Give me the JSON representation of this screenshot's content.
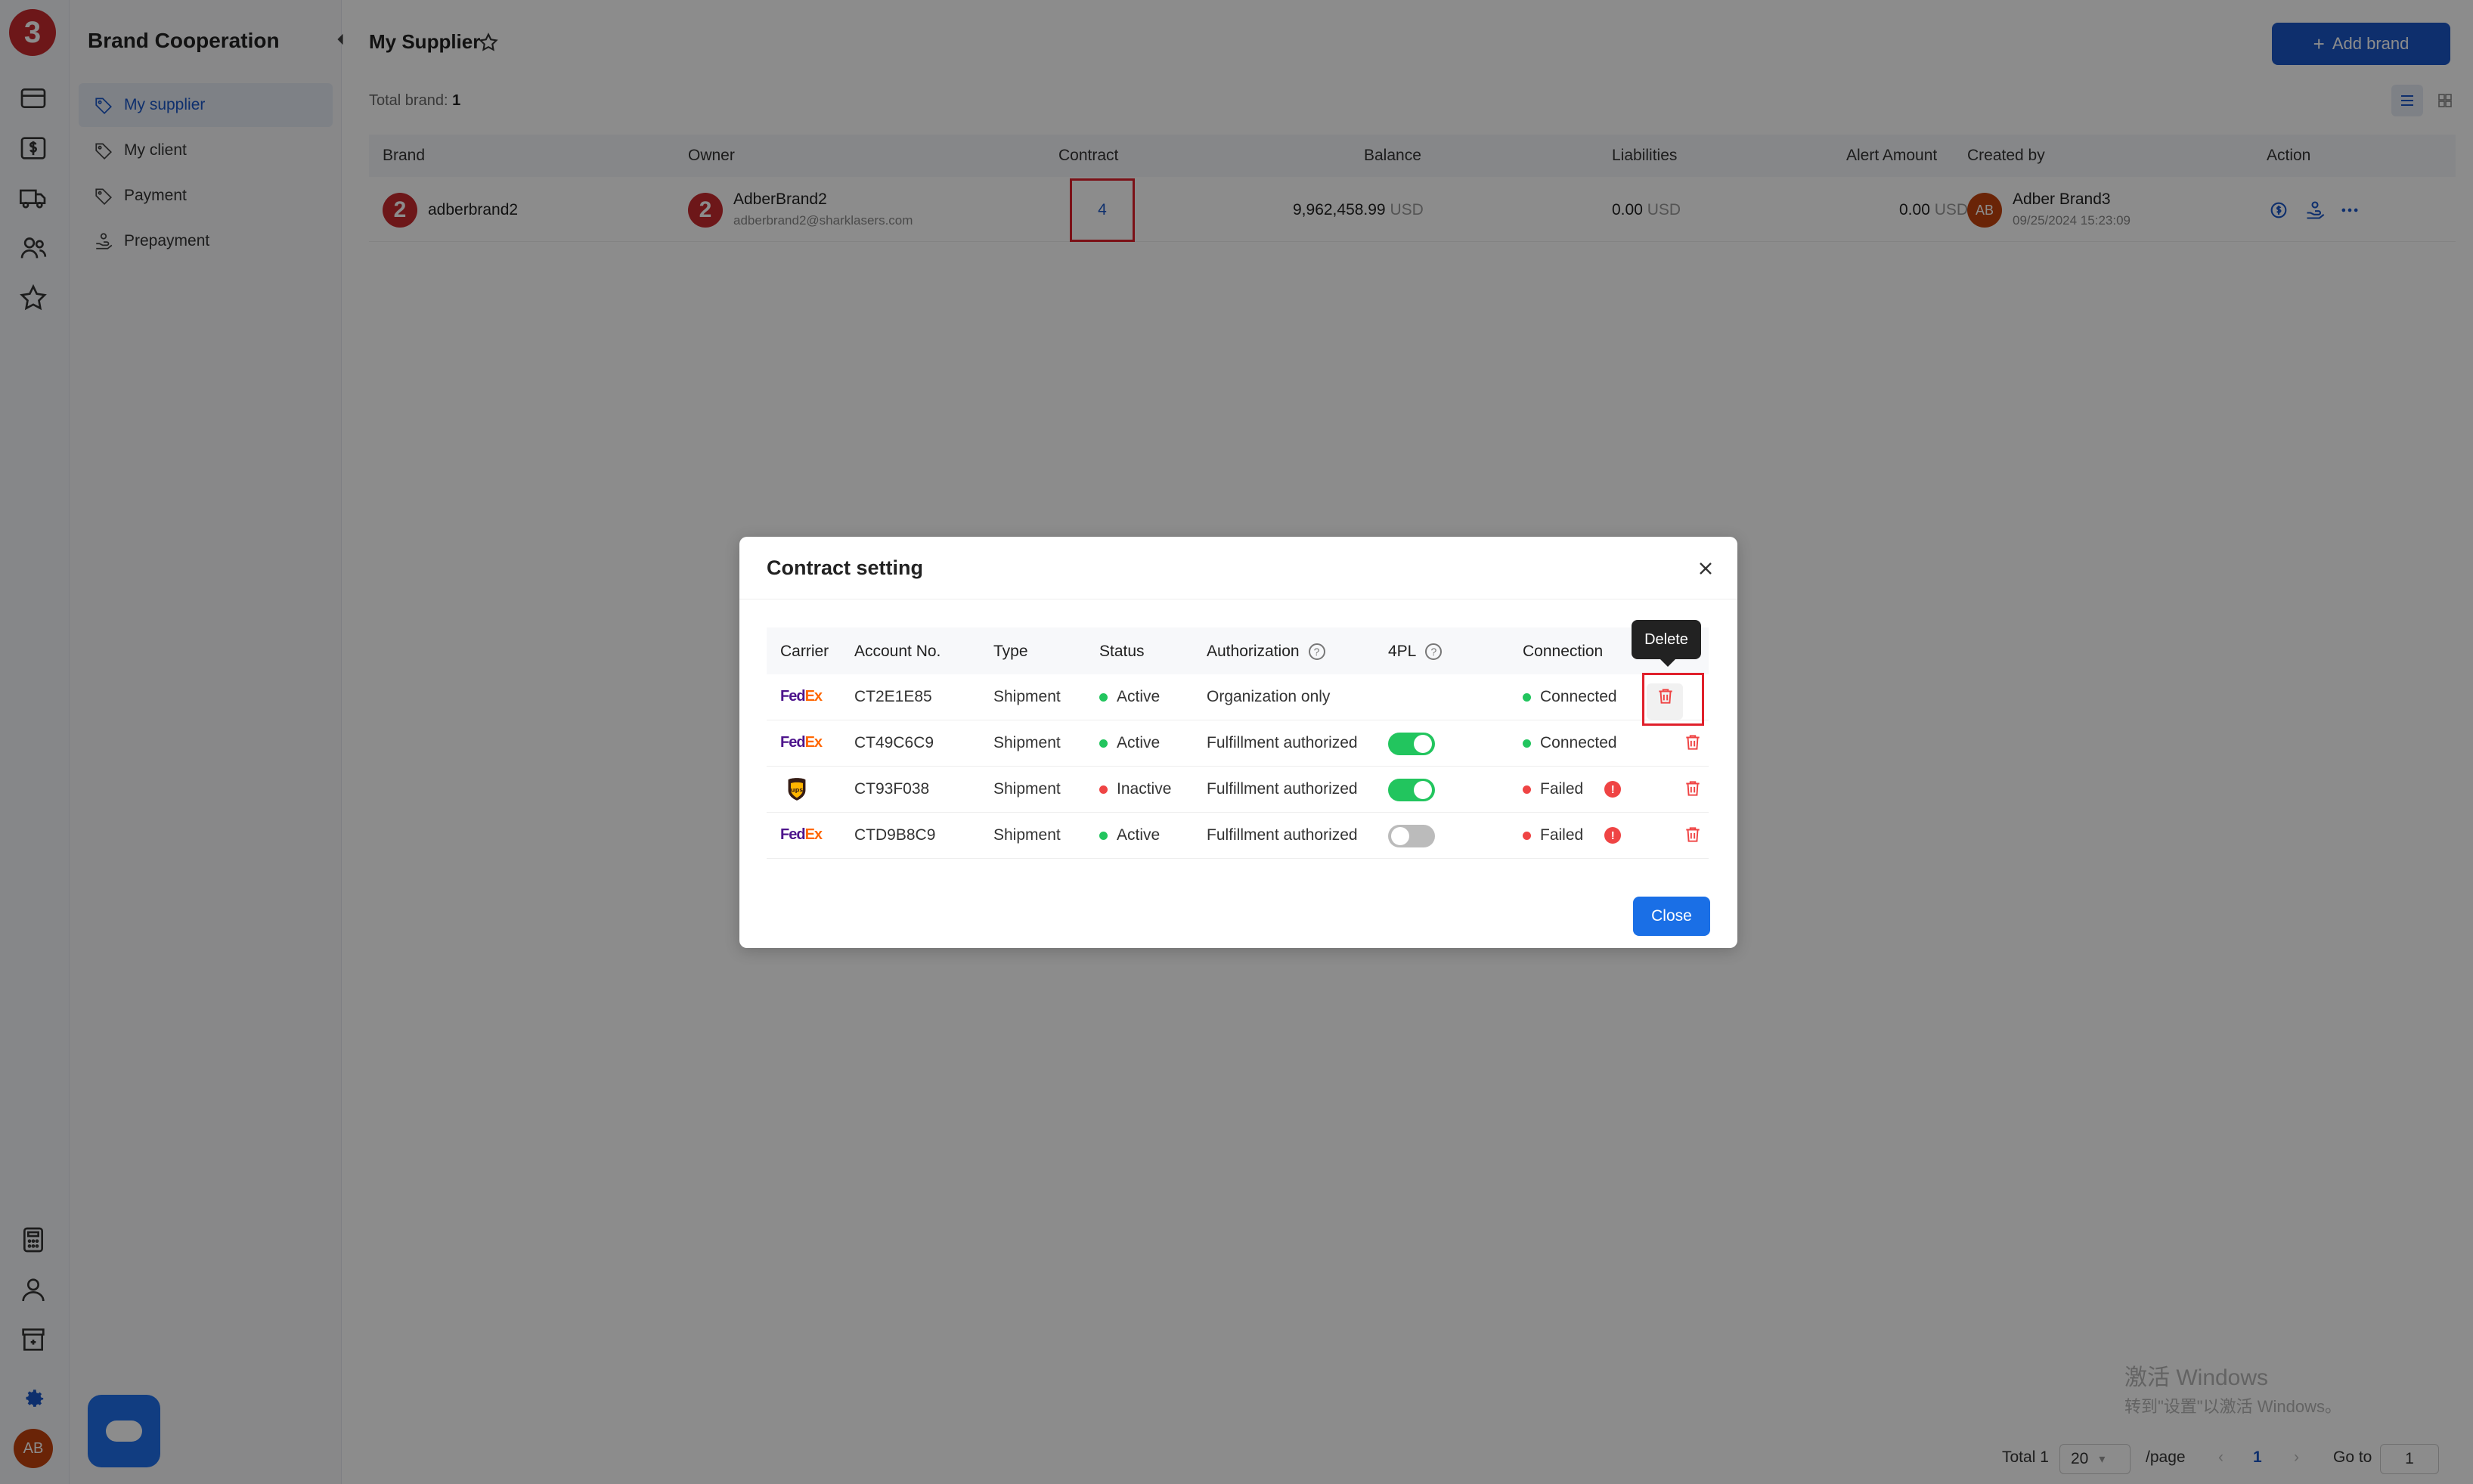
{
  "rail": {
    "logo_number": "3",
    "avatar": "AB",
    "icons": [
      "card-icon",
      "dollar-icon",
      "truck-icon",
      "users-icon",
      "star-icon",
      "calculator-icon",
      "user-icon",
      "store-icon",
      "settings-icon"
    ]
  },
  "sidebar": {
    "title": "Brand Cooperation",
    "items": [
      {
        "label": "My supplier",
        "icon": "tag-icon",
        "active": true
      },
      {
        "label": "My client",
        "icon": "tag-icon",
        "active": false
      },
      {
        "label": "Payment",
        "icon": "tag-icon",
        "active": false
      },
      {
        "label": "Prepayment",
        "icon": "hand-coin-icon",
        "active": false
      }
    ]
  },
  "header": {
    "title": "My Supplier",
    "add_button": "Add brand",
    "total_label": "Total brand:",
    "total_value": "1"
  },
  "table": {
    "columns": [
      "Brand",
      "Owner",
      "Contract",
      "Balance",
      "Liabilities",
      "Alert Amount",
      "Created by",
      "Action"
    ],
    "rows": [
      {
        "brand_avatar": "2",
        "brand": "adberbrand2",
        "owner_avatar": "2",
        "owner_name": "AdberBrand2",
        "owner_email": "adberbrand2@sharklasers.com",
        "contract": "4",
        "balance": "9,962,458.99",
        "balance_unit": "USD",
        "liabilities": "0.00",
        "liabilities_unit": "USD",
        "alert_amount": "0.00",
        "alert_unit": "USD",
        "creator_avatar": "AB",
        "creator_name": "Adber Brand3",
        "created_at": "09/25/2024 15:23:09"
      }
    ]
  },
  "pagination": {
    "total": "Total 1",
    "page_size": "20",
    "per_page": "/page",
    "current": "1",
    "goto_label": "Go to",
    "goto_value": "1"
  },
  "watermark": {
    "line1": "激活 Windows",
    "line2": "转到\"设置\"以激活 Windows。"
  },
  "modal": {
    "title": "Contract setting",
    "close_label": "Close",
    "tooltip": "Delete",
    "columns": [
      "Carrier",
      "Account No.",
      "Type",
      "Status",
      "Authorization",
      "4PL",
      "Connection"
    ],
    "rows": [
      {
        "carrier": "FedEx",
        "account": "CT2E1E85",
        "type": "Shipment",
        "status": "Active",
        "status_color": "#22c55e",
        "authorization": "Organization only",
        "fourpl": null,
        "connection": "Connected",
        "connection_color": "#22c55e",
        "warn": false
      },
      {
        "carrier": "FedEx",
        "account": "CT49C6C9",
        "type": "Shipment",
        "status": "Active",
        "status_color": "#22c55e",
        "authorization": "Fulfillment authorized",
        "fourpl": true,
        "connection": "Connected",
        "connection_color": "#22c55e",
        "warn": false
      },
      {
        "carrier": "UPS",
        "account": "CT93F038",
        "type": "Shipment",
        "status": "Inactive",
        "status_color": "#ef4444",
        "authorization": "Fulfillment authorized",
        "fourpl": true,
        "connection": "Failed",
        "connection_color": "#ef4444",
        "warn": true
      },
      {
        "carrier": "FedEx",
        "account": "CTD9B8C9",
        "type": "Shipment",
        "status": "Active",
        "status_color": "#22c55e",
        "authorization": "Fulfillment authorized",
        "fourpl": false,
        "connection": "Failed",
        "connection_color": "#ef4444",
        "warn": true
      }
    ]
  },
  "colors": {
    "accent": "#1a57c7",
    "brand_red": "#c72a2e",
    "success": "#22c55e",
    "danger": "#ef4444"
  }
}
